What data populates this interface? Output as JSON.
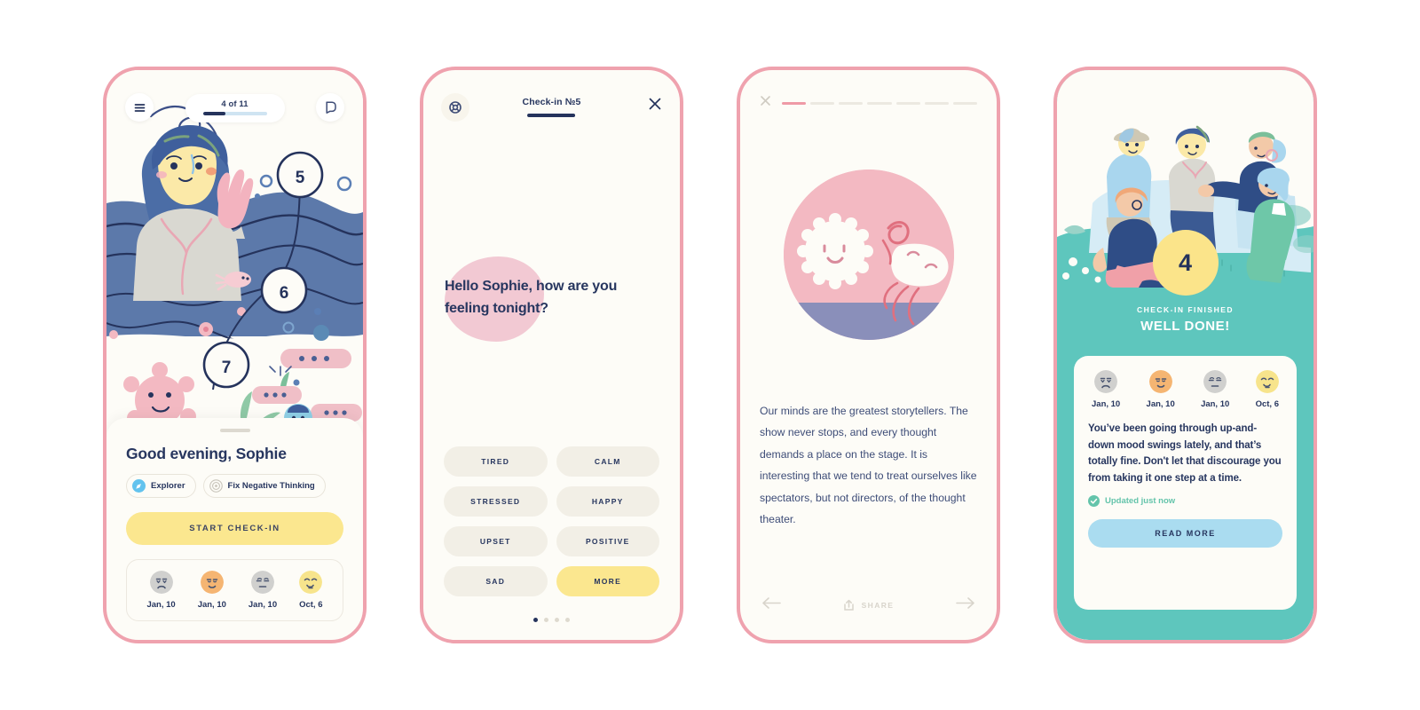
{
  "screen_home": {
    "menu_icon": "hamburger-menu-icon",
    "chat_icon": "speech-bubble-icon",
    "progress_label": "4 of 11",
    "progress_percent": 36,
    "path_nodes": [
      "5",
      "6",
      "7"
    ],
    "greeting": "Good evening, Sophie",
    "chips": [
      {
        "label": "Explorer",
        "icon": "compass-icon",
        "color": "#63c3ee"
      },
      {
        "label": "Fix Negative Thinking",
        "icon": "target-icon",
        "color": "#c9c5bb"
      }
    ],
    "cta_label": "START CHECK-IN",
    "mood_history": [
      {
        "date": "Jan, 10",
        "face": "sad",
        "color": "#d0d0ce"
      },
      {
        "date": "Jan, 10",
        "face": "content",
        "color": "#f5b572"
      },
      {
        "date": "Jan, 10",
        "face": "neutral",
        "color": "#d0d0ce"
      },
      {
        "date": "Oct, 6",
        "face": "happy",
        "color": "#f7e48c"
      }
    ]
  },
  "screen_checkin": {
    "help_icon": "lifebuoy-icon",
    "title": "Check-in №5",
    "close_icon": "close-icon",
    "question": "Hello Sophie, how are you feeling tonight?",
    "mood_options": [
      {
        "label": "TIRED",
        "active": false
      },
      {
        "label": "CALM",
        "active": false
      },
      {
        "label": "STRESSED",
        "active": false
      },
      {
        "label": "HAPPY",
        "active": false
      },
      {
        "label": "UPSET",
        "active": false
      },
      {
        "label": "POSITIVE",
        "active": false
      },
      {
        "label": "SAD",
        "active": false
      },
      {
        "label": "MORE",
        "active": true
      }
    ],
    "pagination": {
      "total": 4,
      "active_index": 0
    }
  },
  "screen_story": {
    "close_icon": "close-icon",
    "segments_total": 7,
    "segments_active": 1,
    "body": "Our minds are the greatest storytellers. The show never stops, and every thought demands a place on the stage. It is interesting that we tend to treat ourselves like spectators, but not directors, of the thought theater.",
    "back_icon": "arrow-left-icon",
    "share_label": "SHARE",
    "share_icon": "share-upload-icon",
    "next_icon": "arrow-right-icon"
  },
  "screen_done": {
    "badge_number": "4",
    "kicker": "CHECK-IN FINISHED",
    "title": "WELL DONE!",
    "mood_history": [
      {
        "date": "Jan, 10",
        "face": "sad",
        "color": "#d0d0ce"
      },
      {
        "date": "Jan, 10",
        "face": "content",
        "color": "#f5b572"
      },
      {
        "date": "Jan, 10",
        "face": "neutral",
        "color": "#d0d0ce"
      },
      {
        "date": "Oct, 6",
        "face": "happy",
        "color": "#f7e48c"
      }
    ],
    "body": "You’ve been going through up-and-down mood swings lately, and that’s totally fine. Don't let that discourage you from taking it one step at a time.",
    "updated_label": "Updated just now",
    "updated_icon": "check-circle-icon",
    "read_more_label": "READ MORE"
  },
  "theme": {
    "frame": "#efa2ae",
    "paper": "#fdfcf7",
    "navy": "#27365f",
    "yellow": "#fbe78f",
    "teal": "#5ec6bd",
    "blue": "#aadcf0",
    "pink": "#f3b9c2"
  }
}
